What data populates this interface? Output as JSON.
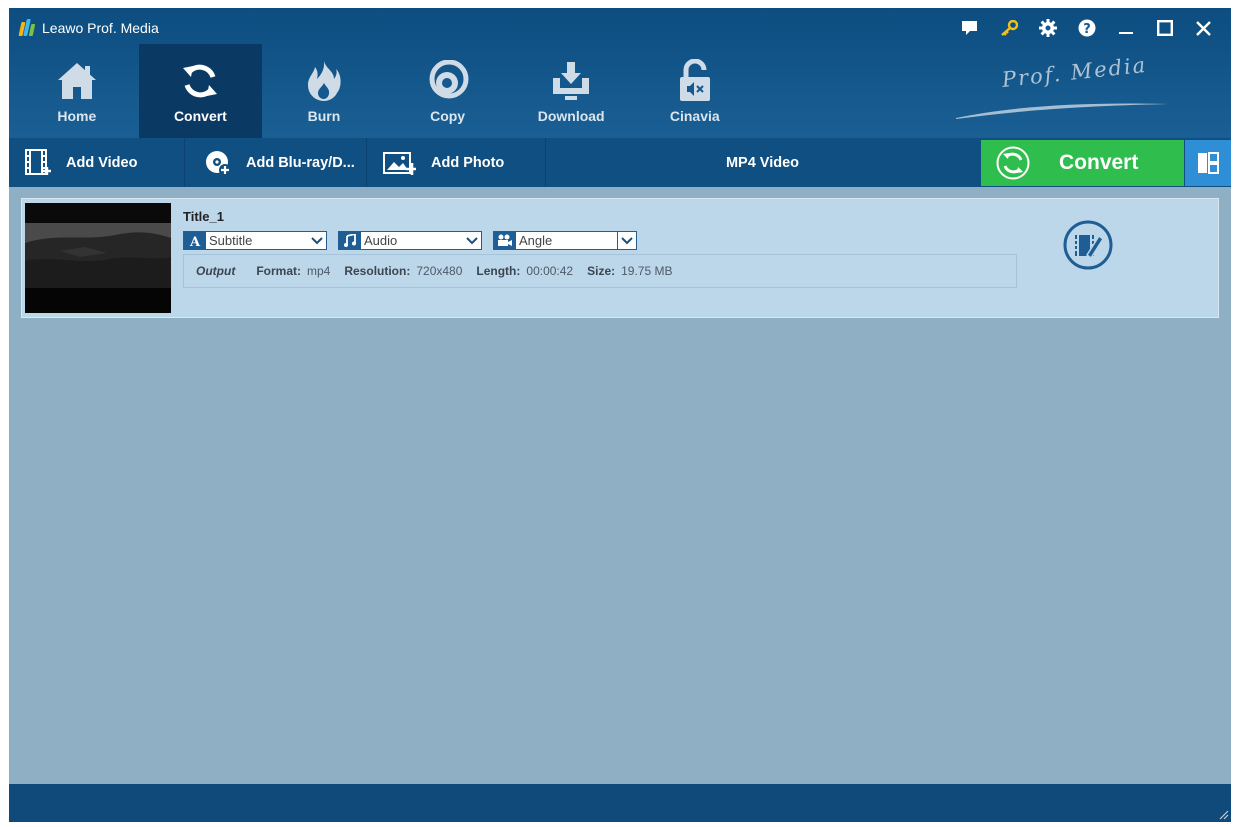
{
  "window": {
    "title": "Leawo Prof. Media"
  },
  "colors": {
    "header": "#0d4d80",
    "toolbar": "#104f82",
    "convert": "#2fbe4e",
    "content": "#8fafc4",
    "item": "#bcd6ea"
  },
  "nav": [
    {
      "label": "Home",
      "icon": "home-icon"
    },
    {
      "label": "Convert",
      "icon": "convert-icon",
      "active": true
    },
    {
      "label": "Burn",
      "icon": "burn-icon"
    },
    {
      "label": "Copy",
      "icon": "copy-icon"
    },
    {
      "label": "Download",
      "icon": "download-icon"
    },
    {
      "label": "Cinavia",
      "icon": "cinavia-icon"
    }
  ],
  "brand": "Prof. Media",
  "toolbar": {
    "add_video": "Add Video",
    "add_bluray": "Add Blu-ray/D...",
    "add_photo": "Add Photo",
    "format": "MP4 Video",
    "convert": "Convert"
  },
  "file": {
    "title": "Title_1",
    "subtitle": "Subtitle",
    "audio": "Audio",
    "angle": "Angle",
    "output_label": "Output",
    "format_key": "Format:",
    "format_val": "mp4",
    "resolution_key": "Resolution:",
    "resolution_val": "720x480",
    "length_key": "Length:",
    "length_val": "00:00:42",
    "size_key": "Size:",
    "size_val": "19.75 MB"
  }
}
